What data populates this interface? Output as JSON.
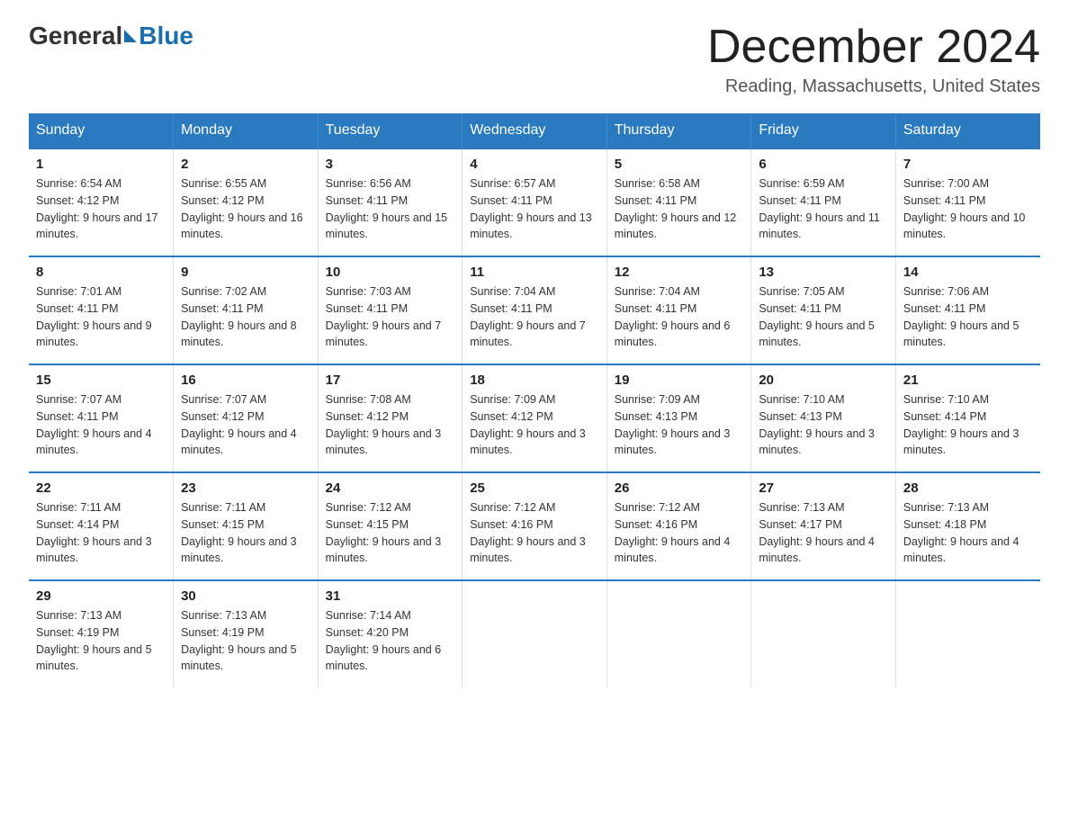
{
  "logo": {
    "general": "General",
    "blue": "Blue"
  },
  "title": "December 2024",
  "location": "Reading, Massachusetts, United States",
  "weekdays": [
    "Sunday",
    "Monday",
    "Tuesday",
    "Wednesday",
    "Thursday",
    "Friday",
    "Saturday"
  ],
  "weeks": [
    [
      {
        "day": "1",
        "sunrise": "6:54 AM",
        "sunset": "4:12 PM",
        "daylight": "9 hours and 17 minutes."
      },
      {
        "day": "2",
        "sunrise": "6:55 AM",
        "sunset": "4:12 PM",
        "daylight": "9 hours and 16 minutes."
      },
      {
        "day": "3",
        "sunrise": "6:56 AM",
        "sunset": "4:11 PM",
        "daylight": "9 hours and 15 minutes."
      },
      {
        "day": "4",
        "sunrise": "6:57 AM",
        "sunset": "4:11 PM",
        "daylight": "9 hours and 13 minutes."
      },
      {
        "day": "5",
        "sunrise": "6:58 AM",
        "sunset": "4:11 PM",
        "daylight": "9 hours and 12 minutes."
      },
      {
        "day": "6",
        "sunrise": "6:59 AM",
        "sunset": "4:11 PM",
        "daylight": "9 hours and 11 minutes."
      },
      {
        "day": "7",
        "sunrise": "7:00 AM",
        "sunset": "4:11 PM",
        "daylight": "9 hours and 10 minutes."
      }
    ],
    [
      {
        "day": "8",
        "sunrise": "7:01 AM",
        "sunset": "4:11 PM",
        "daylight": "9 hours and 9 minutes."
      },
      {
        "day": "9",
        "sunrise": "7:02 AM",
        "sunset": "4:11 PM",
        "daylight": "9 hours and 8 minutes."
      },
      {
        "day": "10",
        "sunrise": "7:03 AM",
        "sunset": "4:11 PM",
        "daylight": "9 hours and 7 minutes."
      },
      {
        "day": "11",
        "sunrise": "7:04 AM",
        "sunset": "4:11 PM",
        "daylight": "9 hours and 7 minutes."
      },
      {
        "day": "12",
        "sunrise": "7:04 AM",
        "sunset": "4:11 PM",
        "daylight": "9 hours and 6 minutes."
      },
      {
        "day": "13",
        "sunrise": "7:05 AM",
        "sunset": "4:11 PM",
        "daylight": "9 hours and 5 minutes."
      },
      {
        "day": "14",
        "sunrise": "7:06 AM",
        "sunset": "4:11 PM",
        "daylight": "9 hours and 5 minutes."
      }
    ],
    [
      {
        "day": "15",
        "sunrise": "7:07 AM",
        "sunset": "4:11 PM",
        "daylight": "9 hours and 4 minutes."
      },
      {
        "day": "16",
        "sunrise": "7:07 AM",
        "sunset": "4:12 PM",
        "daylight": "9 hours and 4 minutes."
      },
      {
        "day": "17",
        "sunrise": "7:08 AM",
        "sunset": "4:12 PM",
        "daylight": "9 hours and 3 minutes."
      },
      {
        "day": "18",
        "sunrise": "7:09 AM",
        "sunset": "4:12 PM",
        "daylight": "9 hours and 3 minutes."
      },
      {
        "day": "19",
        "sunrise": "7:09 AM",
        "sunset": "4:13 PM",
        "daylight": "9 hours and 3 minutes."
      },
      {
        "day": "20",
        "sunrise": "7:10 AM",
        "sunset": "4:13 PM",
        "daylight": "9 hours and 3 minutes."
      },
      {
        "day": "21",
        "sunrise": "7:10 AM",
        "sunset": "4:14 PM",
        "daylight": "9 hours and 3 minutes."
      }
    ],
    [
      {
        "day": "22",
        "sunrise": "7:11 AM",
        "sunset": "4:14 PM",
        "daylight": "9 hours and 3 minutes."
      },
      {
        "day": "23",
        "sunrise": "7:11 AM",
        "sunset": "4:15 PM",
        "daylight": "9 hours and 3 minutes."
      },
      {
        "day": "24",
        "sunrise": "7:12 AM",
        "sunset": "4:15 PM",
        "daylight": "9 hours and 3 minutes."
      },
      {
        "day": "25",
        "sunrise": "7:12 AM",
        "sunset": "4:16 PM",
        "daylight": "9 hours and 3 minutes."
      },
      {
        "day": "26",
        "sunrise": "7:12 AM",
        "sunset": "4:16 PM",
        "daylight": "9 hours and 4 minutes."
      },
      {
        "day": "27",
        "sunrise": "7:13 AM",
        "sunset": "4:17 PM",
        "daylight": "9 hours and 4 minutes."
      },
      {
        "day": "28",
        "sunrise": "7:13 AM",
        "sunset": "4:18 PM",
        "daylight": "9 hours and 4 minutes."
      }
    ],
    [
      {
        "day": "29",
        "sunrise": "7:13 AM",
        "sunset": "4:19 PM",
        "daylight": "9 hours and 5 minutes."
      },
      {
        "day": "30",
        "sunrise": "7:13 AM",
        "sunset": "4:19 PM",
        "daylight": "9 hours and 5 minutes."
      },
      {
        "day": "31",
        "sunrise": "7:14 AM",
        "sunset": "4:20 PM",
        "daylight": "9 hours and 6 minutes."
      },
      null,
      null,
      null,
      null
    ]
  ]
}
